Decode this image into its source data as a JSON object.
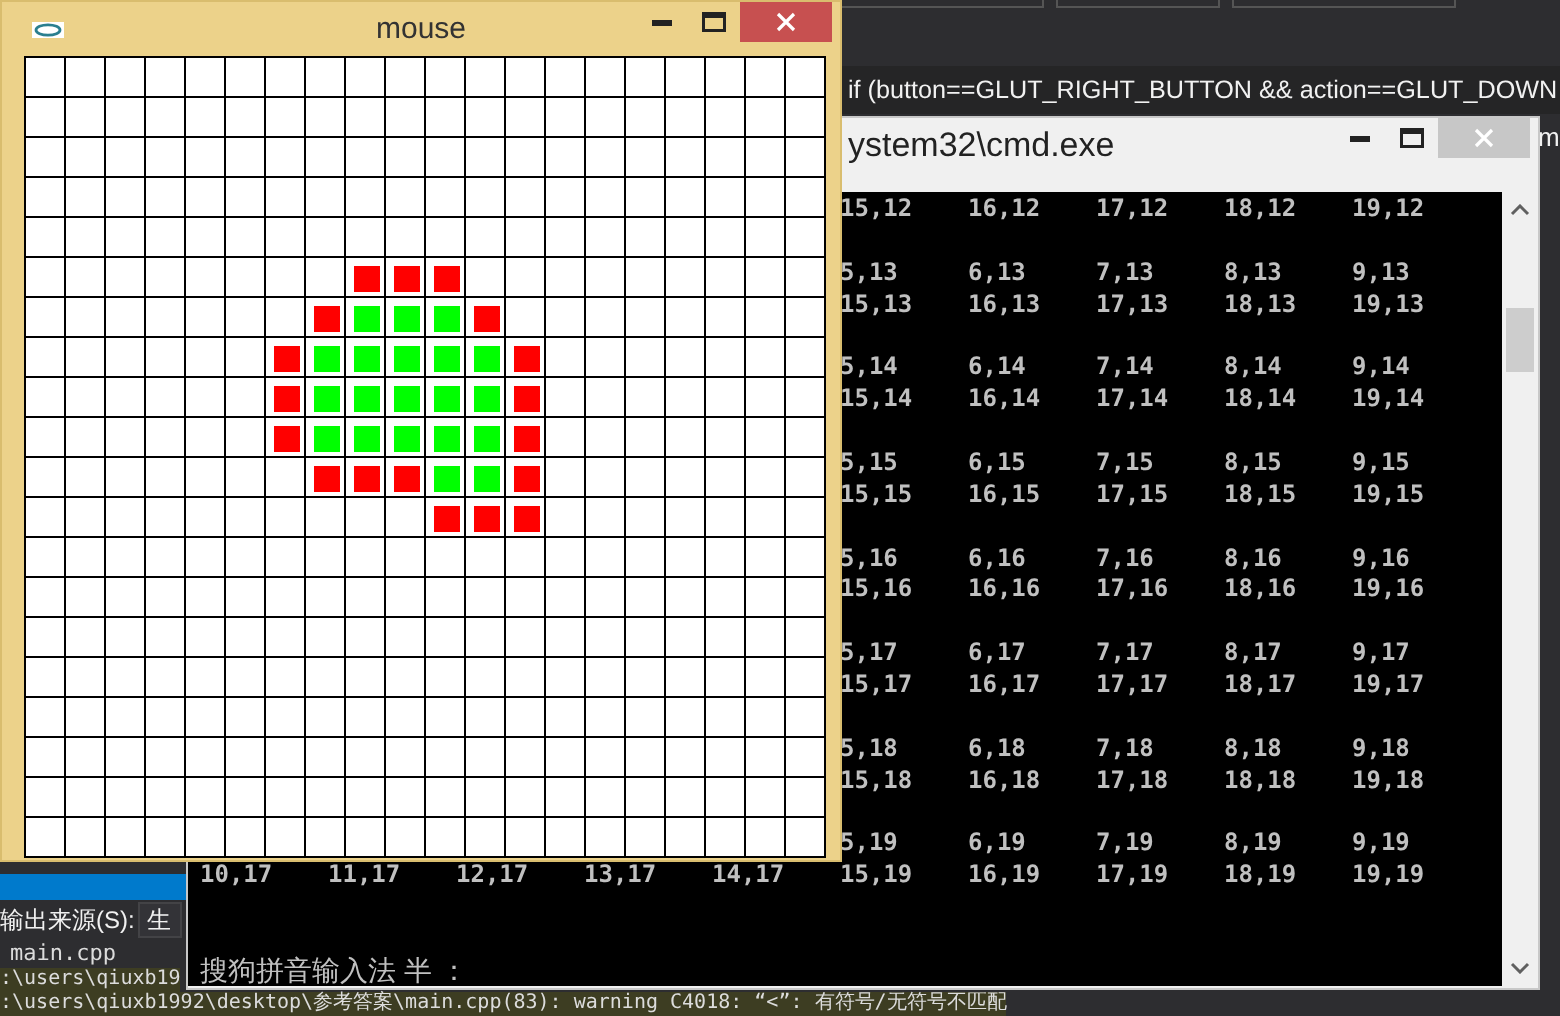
{
  "ide": {
    "code_line": "if (button==GLUT_RIGHT_BUTTON && action==GLUT_DOWN",
    "side_text": "m"
  },
  "output_panel": {
    "source_label": "输出来源(S):",
    "source_value": "生",
    "lines": [
      {
        "kind": "file",
        "text": "main.cpp"
      },
      {
        "kind": "path",
        "text": ":\\users\\qiuxb19"
      },
      {
        "kind": "warning",
        "text": ":\\users\\qiuxb1992\\desktop\\参考答案\\main.cpp(83): warning C4018: “<”: 有符号/无符号不匹配"
      }
    ]
  },
  "cmd_window": {
    "title": "ystem32\\cmd.exe",
    "lines": [
      {
        "kind": "right",
        "cells": [
          "15,12",
          "16,12",
          "17,12",
          "18,12",
          "19,12"
        ]
      },
      {
        "kind": "blank"
      },
      {
        "kind": "right",
        "cells": [
          "5,13",
          "6,13",
          "7,13",
          "8,13",
          "9,13"
        ]
      },
      {
        "kind": "right",
        "cells": [
          "15,13",
          "16,13",
          "17,13",
          "18,13",
          "19,13"
        ]
      },
      {
        "kind": "blank"
      },
      {
        "kind": "right",
        "cells": [
          "5,14",
          "6,14",
          "7,14",
          "8,14",
          "9,14"
        ]
      },
      {
        "kind": "right",
        "cells": [
          "15,14",
          "16,14",
          "17,14",
          "18,14",
          "19,14"
        ]
      },
      {
        "kind": "blank"
      },
      {
        "kind": "right",
        "cells": [
          "5,15",
          "6,15",
          "7,15",
          "8,15",
          "9,15"
        ]
      },
      {
        "kind": "right",
        "cells": [
          "15,15",
          "16,15",
          "17,15",
          "18,15",
          "19,15"
        ]
      },
      {
        "kind": "blank"
      },
      {
        "kind": "right",
        "cells": [
          "5,16",
          "6,16",
          "7,16",
          "8,16",
          "9,16"
        ]
      },
      {
        "kind": "right",
        "cells": [
          "15,16",
          "16,16",
          "17,16",
          "18,16",
          "19,16"
        ]
      },
      {
        "kind": "blank"
      },
      {
        "kind": "right",
        "cells": [
          "5,17",
          "6,17",
          "7,17",
          "8,17",
          "9,17"
        ]
      },
      {
        "kind": "right",
        "cells": [
          "15,17",
          "16,17",
          "17,17",
          "18,17",
          "19,17"
        ]
      },
      {
        "kind": "blank"
      },
      {
        "kind": "right",
        "cells": [
          "5,18",
          "6,18",
          "7,18",
          "8,18",
          "9,18"
        ]
      },
      {
        "kind": "right",
        "cells": [
          "15,18",
          "16,18",
          "17,18",
          "18,18",
          "19,18"
        ]
      },
      {
        "kind": "blank"
      },
      {
        "kind": "right",
        "cells": [
          "5,19",
          "6,19",
          "7,19",
          "8,19",
          "9,19"
        ]
      },
      {
        "kind": "full",
        "cells": [
          "10,17",
          "11,17",
          "12,17",
          "13,17",
          "14,17",
          "15,19",
          "16,19",
          "17,19",
          "18,19",
          "19,19"
        ]
      },
      {
        "kind": "blank"
      },
      {
        "kind": "blank"
      },
      {
        "kind": "text",
        "text": "搜狗拼音输入法 半 ："
      }
    ]
  },
  "mouse_window": {
    "title": "mouse",
    "grid_rows": [
      {
        "kind": "empty"
      },
      {
        "kind": "empty"
      },
      {
        "kind": "empty"
      },
      {
        "kind": "empty"
      },
      {
        "kind": "empty"
      },
      {
        "kind": "marked",
        "cells": [
          {
            "kind": "empty"
          },
          {
            "kind": "empty"
          },
          {
            "kind": "empty"
          },
          {
            "kind": "empty"
          },
          {
            "kind": "empty"
          },
          {
            "kind": "empty"
          },
          {
            "kind": "empty"
          },
          {
            "kind": "empty"
          },
          {
            "kind": "square",
            "color": "#ff0000"
          },
          {
            "kind": "square",
            "color": "#ff0000"
          },
          {
            "kind": "square",
            "color": "#ff0000"
          },
          {
            "kind": "empty"
          },
          {
            "kind": "empty"
          },
          {
            "kind": "empty"
          },
          {
            "kind": "empty"
          },
          {
            "kind": "empty"
          },
          {
            "kind": "empty"
          },
          {
            "kind": "empty"
          },
          {
            "kind": "empty"
          },
          {
            "kind": "empty"
          }
        ]
      },
      {
        "kind": "marked",
        "cells": [
          {
            "kind": "empty"
          },
          {
            "kind": "empty"
          },
          {
            "kind": "empty"
          },
          {
            "kind": "empty"
          },
          {
            "kind": "empty"
          },
          {
            "kind": "empty"
          },
          {
            "kind": "empty"
          },
          {
            "kind": "square",
            "color": "#ff0000"
          },
          {
            "kind": "square",
            "color": "#00ff00"
          },
          {
            "kind": "square",
            "color": "#00ff00"
          },
          {
            "kind": "square",
            "color": "#00ff00"
          },
          {
            "kind": "square",
            "color": "#ff0000"
          },
          {
            "kind": "empty"
          },
          {
            "kind": "empty"
          },
          {
            "kind": "empty"
          },
          {
            "kind": "empty"
          },
          {
            "kind": "empty"
          },
          {
            "kind": "empty"
          },
          {
            "kind": "empty"
          },
          {
            "kind": "empty"
          }
        ]
      },
      {
        "kind": "marked",
        "cells": [
          {
            "kind": "empty"
          },
          {
            "kind": "empty"
          },
          {
            "kind": "empty"
          },
          {
            "kind": "empty"
          },
          {
            "kind": "empty"
          },
          {
            "kind": "empty"
          },
          {
            "kind": "square",
            "color": "#ff0000"
          },
          {
            "kind": "square",
            "color": "#00ff00"
          },
          {
            "kind": "square",
            "color": "#00ff00"
          },
          {
            "kind": "square",
            "color": "#00ff00"
          },
          {
            "kind": "square",
            "color": "#00ff00"
          },
          {
            "kind": "square",
            "color": "#00ff00"
          },
          {
            "kind": "square",
            "color": "#ff0000"
          },
          {
            "kind": "empty"
          },
          {
            "kind": "empty"
          },
          {
            "kind": "empty"
          },
          {
            "kind": "empty"
          },
          {
            "kind": "empty"
          },
          {
            "kind": "empty"
          },
          {
            "kind": "empty"
          }
        ]
      },
      {
        "kind": "marked",
        "cells": [
          {
            "kind": "empty"
          },
          {
            "kind": "empty"
          },
          {
            "kind": "empty"
          },
          {
            "kind": "empty"
          },
          {
            "kind": "empty"
          },
          {
            "kind": "empty"
          },
          {
            "kind": "square",
            "color": "#ff0000"
          },
          {
            "kind": "square",
            "color": "#00ff00"
          },
          {
            "kind": "square",
            "color": "#00ff00"
          },
          {
            "kind": "square",
            "color": "#00ff00"
          },
          {
            "kind": "square",
            "color": "#00ff00"
          },
          {
            "kind": "square",
            "color": "#00ff00"
          },
          {
            "kind": "square",
            "color": "#ff0000"
          },
          {
            "kind": "empty"
          },
          {
            "kind": "empty"
          },
          {
            "kind": "empty"
          },
          {
            "kind": "empty"
          },
          {
            "kind": "empty"
          },
          {
            "kind": "empty"
          },
          {
            "kind": "empty"
          }
        ]
      },
      {
        "kind": "marked",
        "cells": [
          {
            "kind": "empty"
          },
          {
            "kind": "empty"
          },
          {
            "kind": "empty"
          },
          {
            "kind": "empty"
          },
          {
            "kind": "empty"
          },
          {
            "kind": "empty"
          },
          {
            "kind": "square",
            "color": "#ff0000"
          },
          {
            "kind": "square",
            "color": "#00ff00"
          },
          {
            "kind": "square",
            "color": "#00ff00"
          },
          {
            "kind": "square",
            "color": "#00ff00"
          },
          {
            "kind": "square",
            "color": "#00ff00"
          },
          {
            "kind": "square",
            "color": "#00ff00"
          },
          {
            "kind": "square",
            "color": "#ff0000"
          },
          {
            "kind": "empty"
          },
          {
            "kind": "empty"
          },
          {
            "kind": "empty"
          },
          {
            "kind": "empty"
          },
          {
            "kind": "empty"
          },
          {
            "kind": "empty"
          },
          {
            "kind": "empty"
          }
        ]
      },
      {
        "kind": "marked",
        "cells": [
          {
            "kind": "empty"
          },
          {
            "kind": "empty"
          },
          {
            "kind": "empty"
          },
          {
            "kind": "empty"
          },
          {
            "kind": "empty"
          },
          {
            "kind": "empty"
          },
          {
            "kind": "empty"
          },
          {
            "kind": "square",
            "color": "#ff0000"
          },
          {
            "kind": "square",
            "color": "#ff0000"
          },
          {
            "kind": "square",
            "color": "#ff0000"
          },
          {
            "kind": "square",
            "color": "#00ff00"
          },
          {
            "kind": "square",
            "color": "#00ff00"
          },
          {
            "kind": "square",
            "color": "#ff0000"
          },
          {
            "kind": "empty"
          },
          {
            "kind": "empty"
          },
          {
            "kind": "empty"
          },
          {
            "kind": "empty"
          },
          {
            "kind": "empty"
          },
          {
            "kind": "empty"
          },
          {
            "kind": "empty"
          }
        ]
      },
      {
        "kind": "marked",
        "cells": [
          {
            "kind": "empty"
          },
          {
            "kind": "empty"
          },
          {
            "kind": "empty"
          },
          {
            "kind": "empty"
          },
          {
            "kind": "empty"
          },
          {
            "kind": "empty"
          },
          {
            "kind": "empty"
          },
          {
            "kind": "empty"
          },
          {
            "kind": "empty"
          },
          {
            "kind": "empty"
          },
          {
            "kind": "square",
            "color": "#ff0000"
          },
          {
            "kind": "square",
            "color": "#ff0000"
          },
          {
            "kind": "square",
            "color": "#ff0000"
          },
          {
            "kind": "empty"
          },
          {
            "kind": "empty"
          },
          {
            "kind": "empty"
          },
          {
            "kind": "empty"
          },
          {
            "kind": "empty"
          },
          {
            "kind": "empty"
          },
          {
            "kind": "empty"
          }
        ]
      },
      {
        "kind": "empty"
      },
      {
        "kind": "empty"
      },
      {
        "kind": "empty"
      },
      {
        "kind": "empty"
      },
      {
        "kind": "empty"
      },
      {
        "kind": "empty"
      },
      {
        "kind": "empty"
      },
      {
        "kind": "empty"
      }
    ]
  }
}
